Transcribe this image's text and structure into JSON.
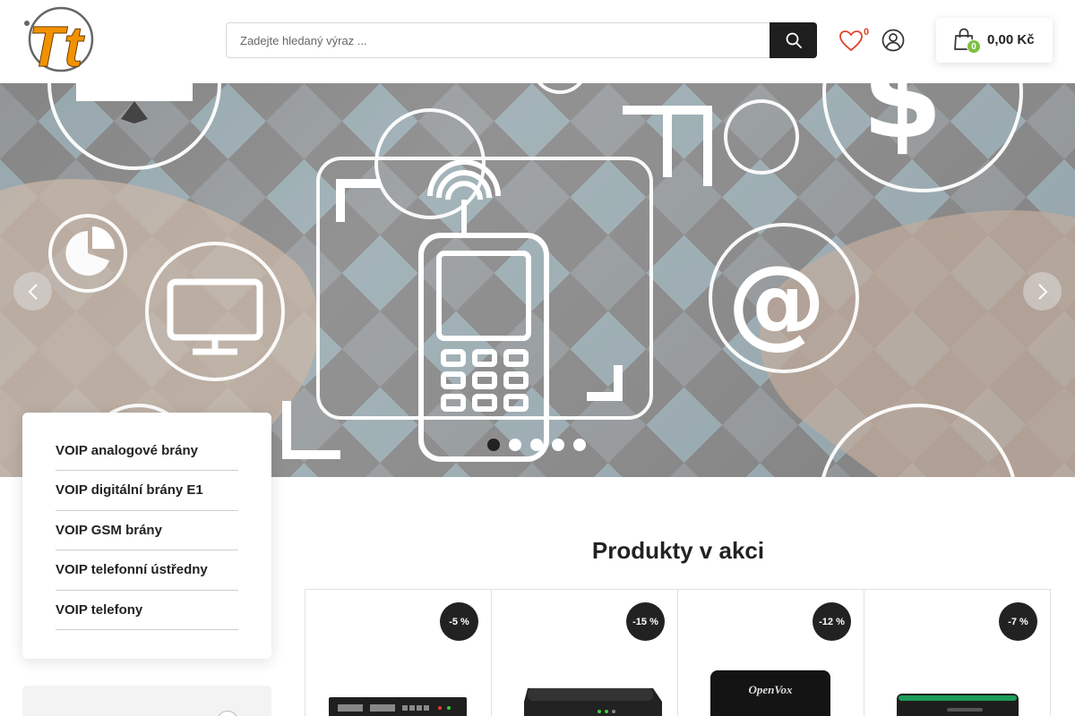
{
  "header": {
    "logo_text": "Tt",
    "search": {
      "placeholder": "Zadejte hledaný výraz ...",
      "value": ""
    },
    "wishlist_count": "0",
    "cart": {
      "count": "0",
      "total": "0,00 Kč"
    }
  },
  "hero": {
    "slides_count": 5,
    "active_slide": 1
  },
  "categories": [
    {
      "label": "VOIP analogové brány"
    },
    {
      "label": "VOIP digitální brány E1"
    },
    {
      "label": "VOIP GSM brány"
    },
    {
      "label": "VOIP telefonní ústředny"
    },
    {
      "label": "VOIP telefony"
    }
  ],
  "products_section": {
    "title": "Produkty v akci",
    "items": [
      {
        "discount": "-5 %"
      },
      {
        "discount": "-15 %"
      },
      {
        "discount": "-12 %"
      },
      {
        "discount": "-7 %"
      }
    ]
  },
  "colors": {
    "logo_orange": "#f39200",
    "dark": "#1e1e1e",
    "cart_badge": "#7cc142",
    "wishlist_count": "#e0452b"
  },
  "icons": [
    "search-icon",
    "heart-icon",
    "user-icon",
    "cart-bag-icon",
    "chevron-left-icon",
    "chevron-right-icon"
  ]
}
